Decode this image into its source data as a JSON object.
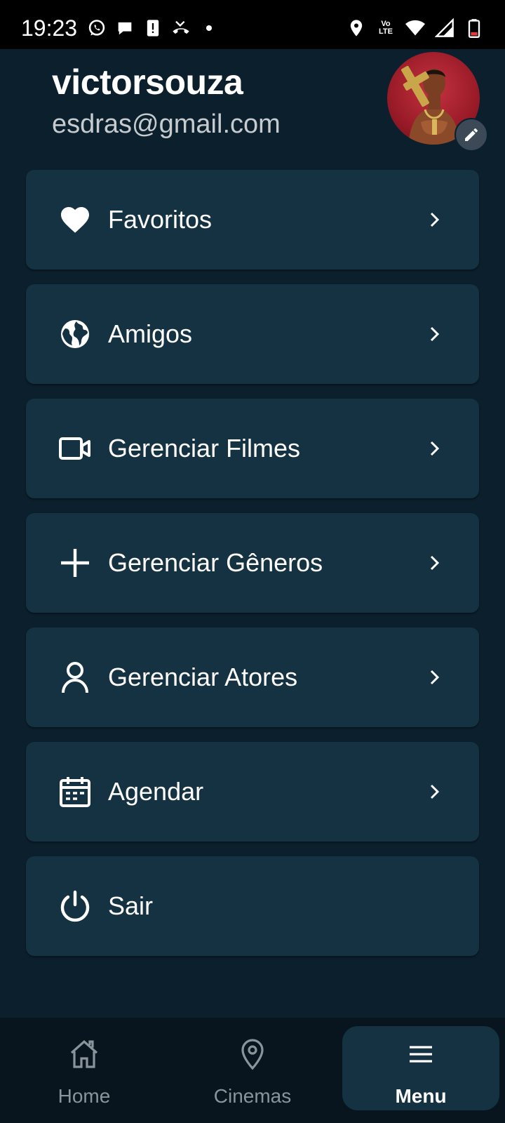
{
  "status_bar": {
    "time": "19:23",
    "left_icons": [
      "whatsapp-icon",
      "chat-bubble-icon",
      "alert-icon",
      "missed-call-icon",
      "dot-icon"
    ],
    "right_icons": [
      "location-icon",
      "volte-icon",
      "wifi-icon",
      "signal-icon",
      "battery-icon"
    ],
    "volte_text_top": "Vo",
    "volte_text_bottom": "LTE"
  },
  "profile": {
    "username": "victorsouza",
    "email": "esdras@gmail.com"
  },
  "menu": [
    {
      "label": "Favoritos",
      "icon": "heart-icon",
      "chevron": true
    },
    {
      "label": "Amigos",
      "icon": "globe-icon",
      "chevron": true
    },
    {
      "label": "Gerenciar Filmes",
      "icon": "video-camera-icon",
      "chevron": true
    },
    {
      "label": "Gerenciar Gêneros",
      "icon": "plus-icon",
      "chevron": true
    },
    {
      "label": "Gerenciar Atores",
      "icon": "person-icon",
      "chevron": true
    },
    {
      "label": "Agendar",
      "icon": "calendar-icon",
      "chevron": true
    },
    {
      "label": "Sair",
      "icon": "power-icon",
      "chevron": false
    }
  ],
  "bottom_nav": {
    "items": [
      {
        "label": "Home",
        "icon": "home-icon"
      },
      {
        "label": "Cinemas",
        "icon": "map-pin-icon"
      },
      {
        "label": "Menu",
        "icon": "hamburger-icon",
        "active": true
      }
    ]
  },
  "colors": {
    "background": "#0b1f2c",
    "card": "#143242",
    "nav_background": "#08151f",
    "text": "#ffffff",
    "muted_text": "#c6cbcf",
    "inactive_nav": "#8a949b"
  }
}
